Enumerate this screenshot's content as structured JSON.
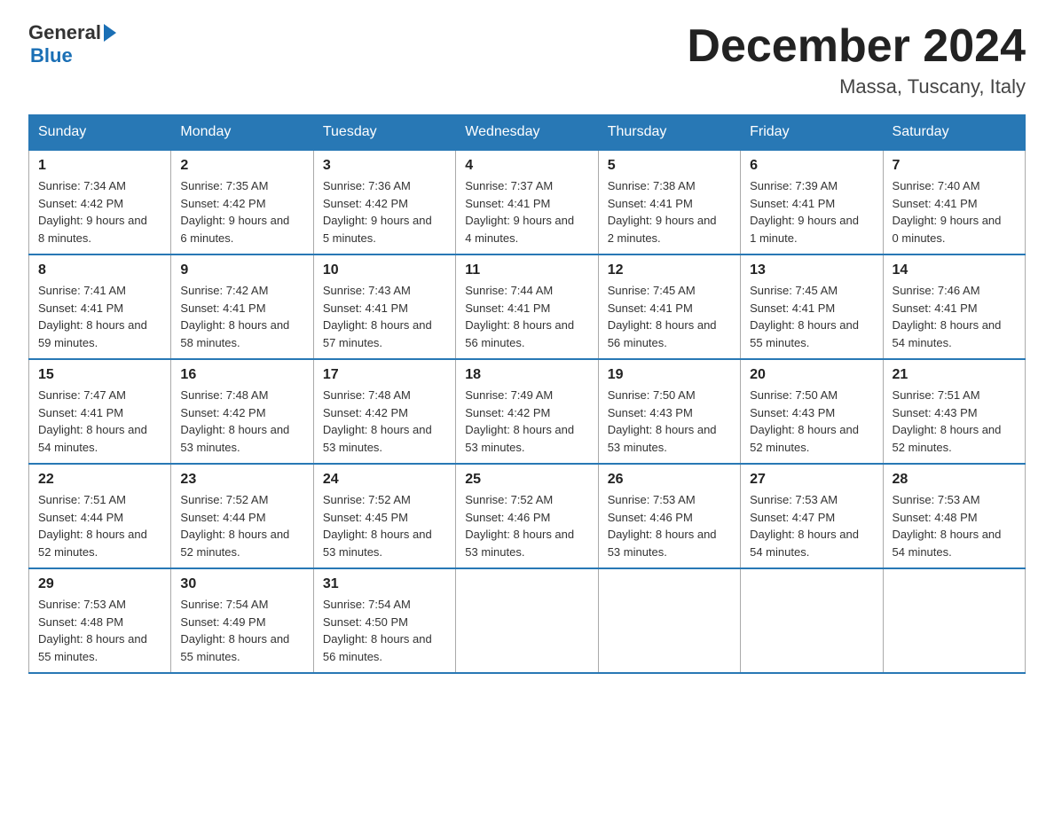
{
  "header": {
    "logo_general": "General",
    "logo_blue": "Blue",
    "month_title": "December 2024",
    "location": "Massa, Tuscany, Italy"
  },
  "days_of_week": [
    "Sunday",
    "Monday",
    "Tuesday",
    "Wednesday",
    "Thursday",
    "Friday",
    "Saturday"
  ],
  "weeks": [
    [
      {
        "day": "1",
        "sunrise": "7:34 AM",
        "sunset": "4:42 PM",
        "daylight": "9 hours and 8 minutes."
      },
      {
        "day": "2",
        "sunrise": "7:35 AM",
        "sunset": "4:42 PM",
        "daylight": "9 hours and 6 minutes."
      },
      {
        "day": "3",
        "sunrise": "7:36 AM",
        "sunset": "4:42 PM",
        "daylight": "9 hours and 5 minutes."
      },
      {
        "day": "4",
        "sunrise": "7:37 AM",
        "sunset": "4:41 PM",
        "daylight": "9 hours and 4 minutes."
      },
      {
        "day": "5",
        "sunrise": "7:38 AM",
        "sunset": "4:41 PM",
        "daylight": "9 hours and 2 minutes."
      },
      {
        "day": "6",
        "sunrise": "7:39 AM",
        "sunset": "4:41 PM",
        "daylight": "9 hours and 1 minute."
      },
      {
        "day": "7",
        "sunrise": "7:40 AM",
        "sunset": "4:41 PM",
        "daylight": "9 hours and 0 minutes."
      }
    ],
    [
      {
        "day": "8",
        "sunrise": "7:41 AM",
        "sunset": "4:41 PM",
        "daylight": "8 hours and 59 minutes."
      },
      {
        "day": "9",
        "sunrise": "7:42 AM",
        "sunset": "4:41 PM",
        "daylight": "8 hours and 58 minutes."
      },
      {
        "day": "10",
        "sunrise": "7:43 AM",
        "sunset": "4:41 PM",
        "daylight": "8 hours and 57 minutes."
      },
      {
        "day": "11",
        "sunrise": "7:44 AM",
        "sunset": "4:41 PM",
        "daylight": "8 hours and 56 minutes."
      },
      {
        "day": "12",
        "sunrise": "7:45 AM",
        "sunset": "4:41 PM",
        "daylight": "8 hours and 56 minutes."
      },
      {
        "day": "13",
        "sunrise": "7:45 AM",
        "sunset": "4:41 PM",
        "daylight": "8 hours and 55 minutes."
      },
      {
        "day": "14",
        "sunrise": "7:46 AM",
        "sunset": "4:41 PM",
        "daylight": "8 hours and 54 minutes."
      }
    ],
    [
      {
        "day": "15",
        "sunrise": "7:47 AM",
        "sunset": "4:41 PM",
        "daylight": "8 hours and 54 minutes."
      },
      {
        "day": "16",
        "sunrise": "7:48 AM",
        "sunset": "4:42 PM",
        "daylight": "8 hours and 53 minutes."
      },
      {
        "day": "17",
        "sunrise": "7:48 AM",
        "sunset": "4:42 PM",
        "daylight": "8 hours and 53 minutes."
      },
      {
        "day": "18",
        "sunrise": "7:49 AM",
        "sunset": "4:42 PM",
        "daylight": "8 hours and 53 minutes."
      },
      {
        "day": "19",
        "sunrise": "7:50 AM",
        "sunset": "4:43 PM",
        "daylight": "8 hours and 53 minutes."
      },
      {
        "day": "20",
        "sunrise": "7:50 AM",
        "sunset": "4:43 PM",
        "daylight": "8 hours and 52 minutes."
      },
      {
        "day": "21",
        "sunrise": "7:51 AM",
        "sunset": "4:43 PM",
        "daylight": "8 hours and 52 minutes."
      }
    ],
    [
      {
        "day": "22",
        "sunrise": "7:51 AM",
        "sunset": "4:44 PM",
        "daylight": "8 hours and 52 minutes."
      },
      {
        "day": "23",
        "sunrise": "7:52 AM",
        "sunset": "4:44 PM",
        "daylight": "8 hours and 52 minutes."
      },
      {
        "day": "24",
        "sunrise": "7:52 AM",
        "sunset": "4:45 PM",
        "daylight": "8 hours and 53 minutes."
      },
      {
        "day": "25",
        "sunrise": "7:52 AM",
        "sunset": "4:46 PM",
        "daylight": "8 hours and 53 minutes."
      },
      {
        "day": "26",
        "sunrise": "7:53 AM",
        "sunset": "4:46 PM",
        "daylight": "8 hours and 53 minutes."
      },
      {
        "day": "27",
        "sunrise": "7:53 AM",
        "sunset": "4:47 PM",
        "daylight": "8 hours and 54 minutes."
      },
      {
        "day": "28",
        "sunrise": "7:53 AM",
        "sunset": "4:48 PM",
        "daylight": "8 hours and 54 minutes."
      }
    ],
    [
      {
        "day": "29",
        "sunrise": "7:53 AM",
        "sunset": "4:48 PM",
        "daylight": "8 hours and 55 minutes."
      },
      {
        "day": "30",
        "sunrise": "7:54 AM",
        "sunset": "4:49 PM",
        "daylight": "8 hours and 55 minutes."
      },
      {
        "day": "31",
        "sunrise": "7:54 AM",
        "sunset": "4:50 PM",
        "daylight": "8 hours and 56 minutes."
      },
      null,
      null,
      null,
      null
    ]
  ],
  "labels": {
    "sunrise": "Sunrise:",
    "sunset": "Sunset:",
    "daylight": "Daylight:"
  }
}
